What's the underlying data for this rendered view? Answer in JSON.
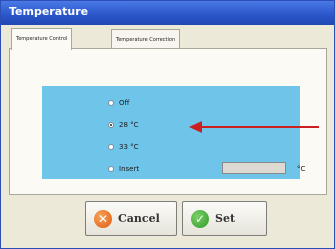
{
  "window": {
    "title": "Temperature"
  },
  "tabs": [
    {
      "label": "Temperature Control",
      "active": true
    },
    {
      "label": "Temperature Correction",
      "active": false
    }
  ],
  "options": [
    {
      "label": "Off",
      "checked": false
    },
    {
      "label": "28 °C",
      "checked": true
    },
    {
      "label": "33 °C",
      "checked": false
    },
    {
      "label": "Insert",
      "checked": false
    }
  ],
  "insert": {
    "value": "",
    "unit": "°C"
  },
  "buttons": {
    "cancel_label": "Cancel",
    "set_label": "Set"
  },
  "colors": {
    "panel_bg": "#6fc4ea",
    "arrow": "#cc1f1f",
    "titlebar": "#2a55c9"
  }
}
